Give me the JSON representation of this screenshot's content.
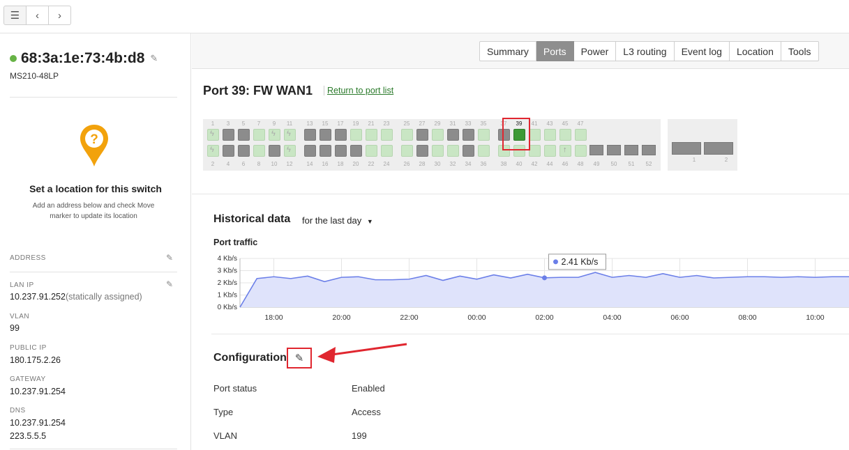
{
  "nav": {
    "list_icon": "list-icon",
    "back_icon": "chevron-left-icon",
    "forward_icon": "chevron-right-icon"
  },
  "device": {
    "mac": "68:3a:1e:73:4b:d8",
    "model": "MS210-48LP",
    "status_color": "#67b346"
  },
  "location_card": {
    "title": "Set a location for this switch",
    "subtitle": "Add an address below and check Move marker to update its location",
    "pin_color": "#f2a20c"
  },
  "sidebar": {
    "address_label": "ADDRESS",
    "lan_ip_label": "LAN IP",
    "lan_ip_value": "10.237.91.252",
    "lan_ip_note": "(statically assigned)",
    "vlan_label": "VLAN",
    "vlan_value": "99",
    "public_ip_label": "PUBLIC IP",
    "public_ip_value": "180.175.2.26",
    "gateway_label": "GATEWAY",
    "gateway_value": "10.237.91.254",
    "dns_label": "DNS",
    "dns_value_1": "10.237.91.254",
    "dns_value_2": "223.5.5.5"
  },
  "tabs": [
    {
      "label": "Summary",
      "active": false
    },
    {
      "label": "Ports",
      "active": true
    },
    {
      "label": "Power",
      "active": false
    },
    {
      "label": "L3 routing",
      "active": false
    },
    {
      "label": "Event log",
      "active": false
    },
    {
      "label": "Location",
      "active": false
    },
    {
      "label": "Tools",
      "active": false
    }
  ],
  "port_header": {
    "title": "Port 39: FW WAN1",
    "return_link": "Return to port list"
  },
  "switch_ports": {
    "top_numbers": [
      "1",
      "3",
      "5",
      "7",
      "9",
      "11",
      "13",
      "15",
      "17",
      "19",
      "21",
      "23",
      "25",
      "27",
      "29",
      "31",
      "33",
      "35",
      "37",
      "39",
      "41",
      "43",
      "45",
      "47"
    ],
    "bottom_numbers": [
      "2",
      "4",
      "6",
      "8",
      "10",
      "12",
      "14",
      "16",
      "18",
      "20",
      "22",
      "24",
      "26",
      "28",
      "30",
      "32",
      "34",
      "36",
      "38",
      "40",
      "42",
      "44",
      "46",
      "48"
    ],
    "top_states": [
      "poe",
      "used",
      "used",
      "empty",
      "poe",
      "poe",
      "used",
      "used",
      "used",
      "empty",
      "empty",
      "empty",
      "empty",
      "used",
      "empty",
      "used",
      "used",
      "empty",
      "used",
      "selected",
      "empty",
      "empty",
      "empty",
      "empty"
    ],
    "bottom_states": [
      "poe",
      "used",
      "used",
      "empty",
      "used",
      "poe",
      "used",
      "used",
      "used",
      "used",
      "empty",
      "empty",
      "empty",
      "used",
      "empty",
      "empty",
      "used",
      "empty",
      "empty",
      "empty",
      "empty",
      "empty",
      "uplink",
      "empty"
    ],
    "module_numbers": [
      "49",
      "50",
      "51",
      "52"
    ],
    "sfp_numbers": [
      "1",
      "2"
    ],
    "selected_port": "39",
    "selected_color": "#3d9a36"
  },
  "historical": {
    "title": "Historical data",
    "range": "for the last day"
  },
  "chart_data": {
    "type": "area",
    "title": "Port traffic",
    "x": [
      "17:00",
      "17:30",
      "18:00",
      "18:30",
      "19:00",
      "19:30",
      "20:00",
      "20:30",
      "21:00",
      "21:30",
      "22:00",
      "22:30",
      "23:00",
      "23:30",
      "00:00",
      "00:30",
      "01:00",
      "01:30",
      "02:00",
      "02:30",
      "03:00",
      "03:30",
      "04:00",
      "04:30",
      "05:00",
      "05:30",
      "06:00",
      "06:30",
      "07:00",
      "07:30",
      "08:00",
      "08:30",
      "09:00",
      "09:30",
      "10:00",
      "10:30",
      "11:00"
    ],
    "values": [
      0,
      2.35,
      2.5,
      2.35,
      2.55,
      2.1,
      2.45,
      2.5,
      2.25,
      2.25,
      2.3,
      2.6,
      2.2,
      2.55,
      2.3,
      2.65,
      2.4,
      2.7,
      2.41,
      2.45,
      2.45,
      2.85,
      2.45,
      2.6,
      2.45,
      2.75,
      2.45,
      2.6,
      2.4,
      2.45,
      2.5,
      2.5,
      2.45,
      2.5,
      2.45,
      2.5,
      2.5
    ],
    "x_tick_labels": [
      "18:00",
      "20:00",
      "22:00",
      "00:00",
      "02:00",
      "04:00",
      "06:00",
      "08:00",
      "10:00"
    ],
    "y_tick_labels": [
      "4 Kb/s",
      "3 Kb/s",
      "2 Kb/s",
      "1 Kb/s",
      "0 Kb/s"
    ],
    "ylim": [
      0,
      4
    ],
    "unit": "Kb/s",
    "tooltip_index": 18,
    "tooltip_label": "2.41 Kb/s",
    "line_color": "#6b7fe8",
    "fill_color": "#dfe3fb",
    "grid": true
  },
  "configuration": {
    "title": "Configuration",
    "rows": [
      {
        "key": "Port status",
        "value": "Enabled"
      },
      {
        "key": "Type",
        "value": "Access"
      },
      {
        "key": "VLAN",
        "value": "199"
      }
    ]
  }
}
